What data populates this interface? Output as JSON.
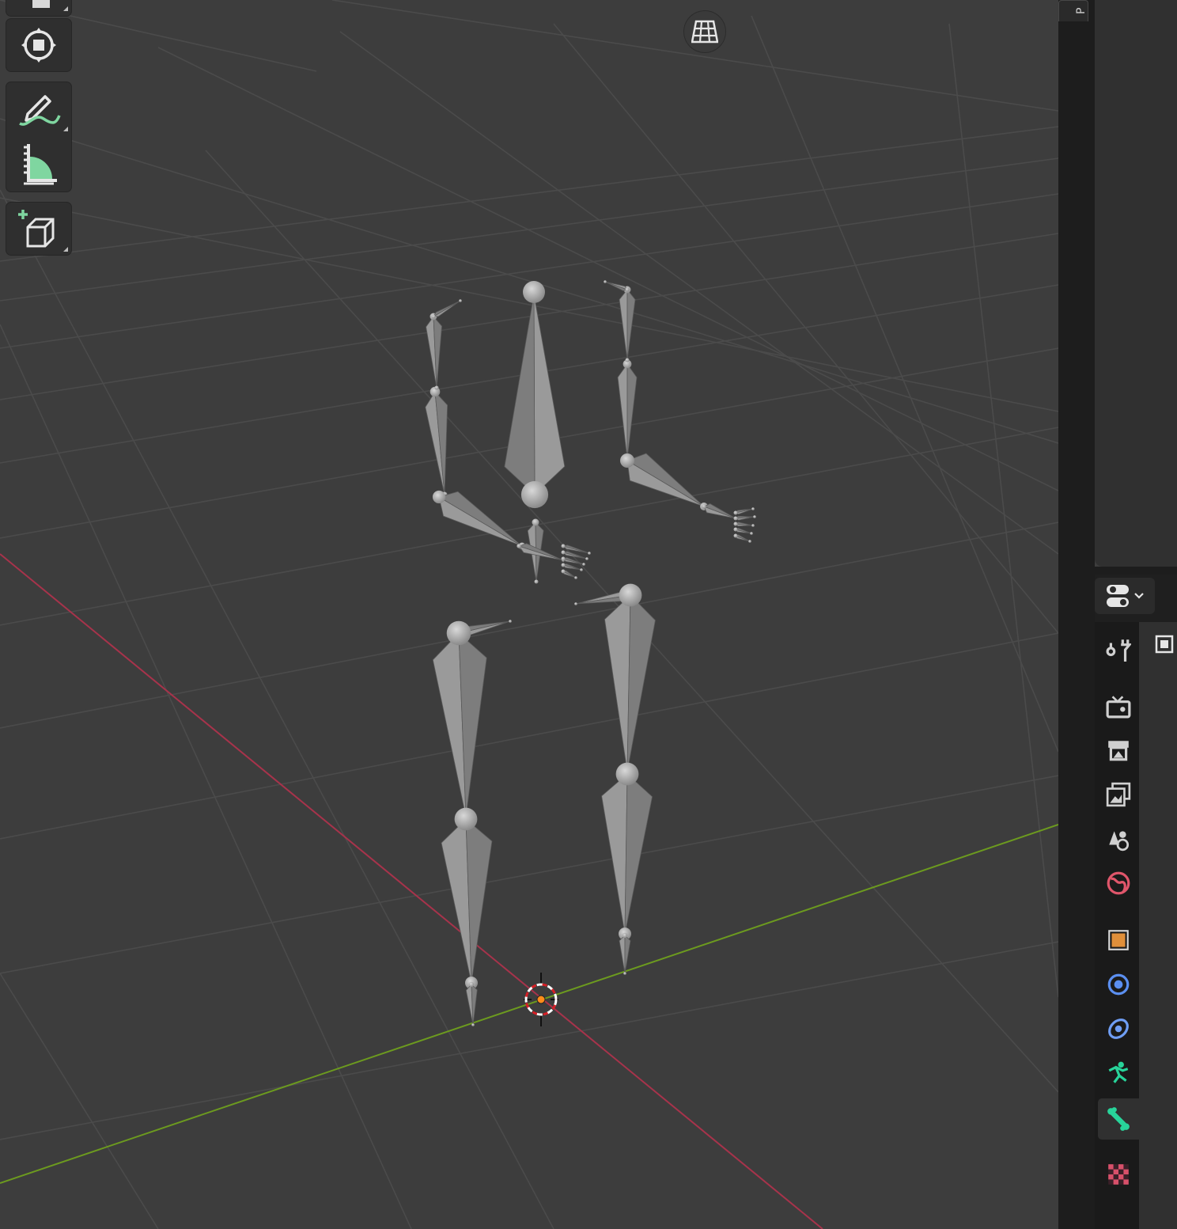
{
  "app": "Blender",
  "viewport": {
    "background": "#3d3d3d",
    "grid_color": "#4a4a4a",
    "x_axis_color": "#b3334d",
    "y_axis_color": "#6b9a1e",
    "bone_color": "#8f8f8f",
    "origin_color": "#ff8c1a"
  },
  "toolbar": {
    "tools": [
      {
        "name": "transform-tool",
        "icon": "transform-icon"
      },
      {
        "name": "annotate-tool",
        "icon": "annotate-pencil-icon"
      },
      {
        "name": "measure-tool",
        "icon": "measure-ruler-icon"
      },
      {
        "name": "add-cube-tool",
        "icon": "add-cube-icon"
      }
    ],
    "accent": "#7fd6a0"
  },
  "navigation": {
    "toggle_icon": "perspective-grid-icon"
  },
  "sidebar": {
    "tab_letter": "P"
  },
  "properties_editor": {
    "editor_type_icon": "properties-toggle-icon",
    "active_tab": "bone",
    "tabs": [
      {
        "id": "tool",
        "icon": "tool-wrench-icon",
        "color": "#d0d0d0"
      },
      {
        "id": "render",
        "icon": "render-camera-icon",
        "color": "#d0d0d0"
      },
      {
        "id": "output",
        "icon": "output-printer-icon",
        "color": "#d0d0d0"
      },
      {
        "id": "view-layer",
        "icon": "view-layer-icon",
        "color": "#d0d0d0"
      },
      {
        "id": "scene",
        "icon": "scene-icon",
        "color": "#d0d0d0"
      },
      {
        "id": "world",
        "icon": "world-icon",
        "color": "#e0566b"
      },
      {
        "id": "object",
        "icon": "object-icon",
        "color": "#e08f3a"
      },
      {
        "id": "modifiers",
        "icon": "physics-icon",
        "color": "#5b8ff0"
      },
      {
        "id": "constraints",
        "icon": "object-constraint-icon",
        "color": "#6f9ef5"
      },
      {
        "id": "armature-data",
        "icon": "armature-data-icon",
        "color": "#28d49a"
      },
      {
        "id": "bone",
        "icon": "bone-icon",
        "color": "#28d49a"
      },
      {
        "id": "texture",
        "icon": "texture-checker-icon",
        "color": "#d8506a"
      }
    ]
  }
}
